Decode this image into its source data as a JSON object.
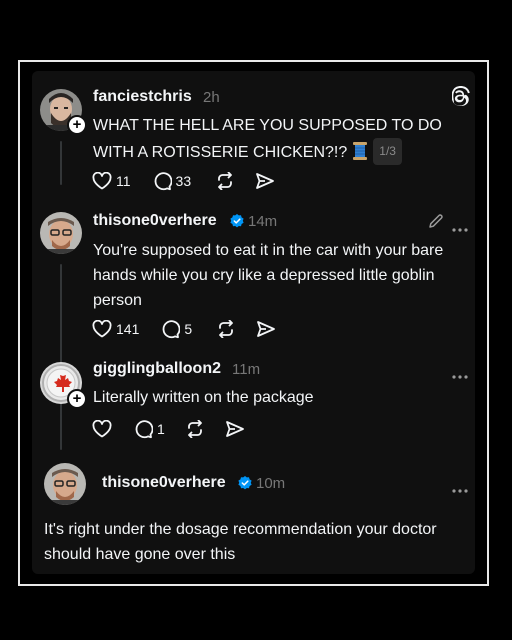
{
  "posts": [
    {
      "username": "fanciestchris",
      "time": "2h",
      "text_line1": "WHAT THE HELL ARE YOU SUPPOSED TO DO",
      "text_line2": "WITH A ROTISSERIE CHICKEN?!?",
      "spool_emoji": "🧵",
      "pager": "1/3",
      "likes": "11",
      "replies": "33"
    },
    {
      "username": "thisone0verhere",
      "time": "14m",
      "text": "You're supposed to eat it in the car with your bare hands while you cry like a depressed little goblin person",
      "likes": "141",
      "replies": "5"
    },
    {
      "username": "gigglingballoon2",
      "time": "11m",
      "text": "Literally written on the package",
      "replies": "1"
    },
    {
      "username": "thisone0verhere",
      "time": "10m",
      "text": "It's right under the dosage recommendation your doctor should have gone over this"
    }
  ],
  "icons": {
    "threads_logo": "threads-logo-icon",
    "heart": "heart-icon",
    "reply": "reply-bubble-icon",
    "repost": "repost-icon",
    "share": "share-send-icon",
    "edit": "pencil-icon",
    "more": "more-dots-icon",
    "verified": "verified-badge-icon"
  },
  "colors": {
    "background": "#101010",
    "verified": "#0095f6",
    "text": "#f3f5f7",
    "muted": "#777777"
  }
}
